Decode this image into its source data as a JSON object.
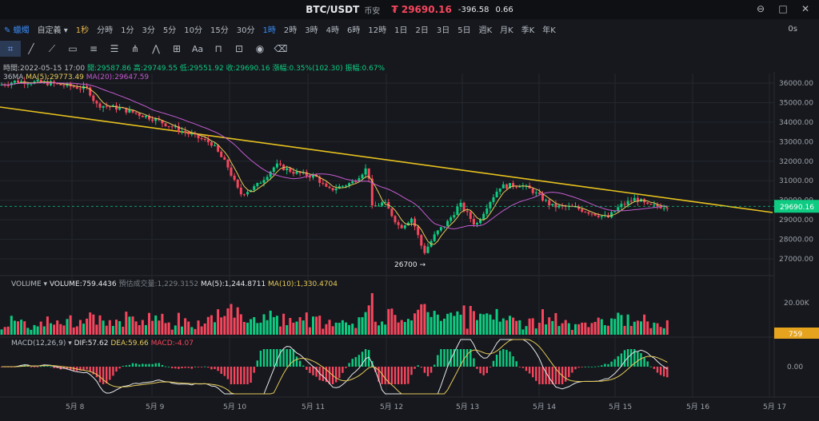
{
  "header": {
    "symbol": "BTC/USDT",
    "exchange": "币安",
    "price": "₮ 29690.16",
    "change": "-396.58",
    "change_pct": "0.66"
  },
  "window_controls": [
    "⊖",
    "□",
    "✕"
  ],
  "intervals": {
    "chart_type": "蠟燭",
    "custom": "自定義",
    "items": [
      "1秒",
      "分時",
      "1分",
      "3分",
      "5分",
      "10分",
      "15分",
      "30分",
      "1時",
      "2時",
      "3時",
      "4時",
      "6時",
      "12時",
      "1日",
      "2日",
      "3日",
      "5日",
      "週K",
      "月K",
      "季K",
      "年K"
    ],
    "active": "1時",
    "right": "0s"
  },
  "draw_tools": [
    "cursor-icon",
    "line-icon",
    "ray-icon",
    "rect-icon",
    "parallel-icon",
    "fib-icon",
    "pitchfork-icon",
    "pattern-icon",
    "measure-icon",
    "text-icon",
    "magnet-icon",
    "lock-icon",
    "eye-icon",
    "trash-icon"
  ],
  "ohlc": {
    "time": "時間:2022-05-15 17:00",
    "open": "開:29587.86",
    "high": "高:29749.55",
    "low": "低:29551.92",
    "close": "收:29690.16",
    "change": "漲幅:0.35%(102.30)",
    "amplitude": "振幅:0.67%"
  },
  "ma_legend": {
    "main": "36MA",
    "ma5": "MA(5):29773.49",
    "ma20": "MA(20):29647.59"
  },
  "volume_legend": {
    "label": "VOLUME",
    "vol": "VOLUME:759.4436",
    "est": "預估成交量:1,229.3152",
    "ma5": "MA(5):1,244.8711",
    "ma10": "MA(10):1,330.4704"
  },
  "macd_legend": {
    "label": "MACD(12,26,9)",
    "dif": "DIF:57.62",
    "dea": "DEA:59.66",
    "macd": "MACD:-4.07"
  },
  "chart_data": {
    "type": "candlestick",
    "price_axis": {
      "ticks": [
        27000,
        28000,
        29000,
        30000,
        31000,
        32000,
        33000,
        34000,
        35000,
        36000
      ],
      "ylim": [
        26500,
        36500
      ]
    },
    "current_price": 29690.16,
    "min_marker": {
      "label": "26700 →",
      "value": 26700
    },
    "x_labels": [
      "5月 8",
      "5月 9",
      "5月 10",
      "5月 11",
      "5月 12",
      "5月 13",
      "5月 14",
      "5月 15",
      "5月 16",
      "5月 17"
    ],
    "volume_axis": {
      "ticks": [
        "20.00K"
      ],
      "current": "759"
    },
    "macd_axis": {
      "ticks": [
        "0.00"
      ]
    },
    "trendline": {
      "color": "#e8c21e"
    },
    "colors": {
      "up": "#0ecb81",
      "down": "#f6465d",
      "ma5": "#e6c95a",
      "ma20": "#c45bd0",
      "bg": "#16181d",
      "grid": "#24272e"
    }
  }
}
